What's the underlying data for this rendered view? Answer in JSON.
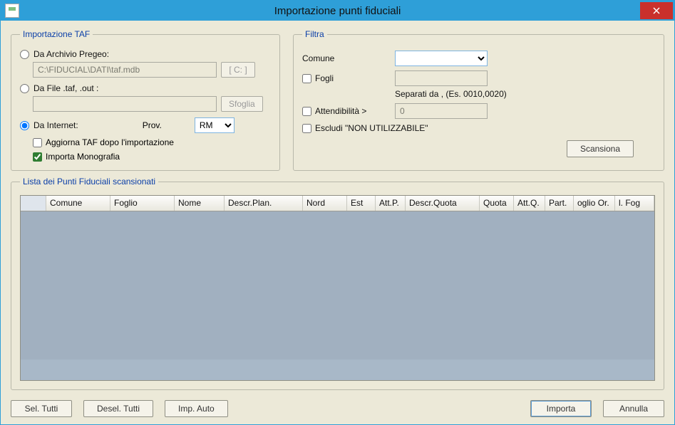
{
  "window": {
    "title": "Importazione punti fiduciali"
  },
  "import_group": {
    "legend": "Importazione TAF",
    "radio_pregeo": "Da Archivio Pregeo:",
    "pregeo_path": "C:\\FIDUCIAL\\DATI\\taf.mdb",
    "drive_btn": "[ C: ]",
    "radio_file": "Da File .taf, .out :",
    "sfoglia_btn": "Sfoglia",
    "radio_internet": "Da Internet:",
    "prov_label": "Prov.",
    "prov_value": "RM",
    "chk_aggiorna": "Aggiorna TAF dopo l'importazione",
    "chk_monografia": "Importa Monografia"
  },
  "filtra_group": {
    "legend": "Filtra",
    "comune_label": "Comune",
    "fogli_label": "Fogli",
    "fogli_hint": "Separati da , (Es. 0010,0020)",
    "attend_label": "Attendibilità >",
    "attend_value": "0",
    "escludi_label": "Escludi \"NON UTILIZZABILE\"",
    "scan_btn": "Scansiona"
  },
  "list_group": {
    "legend": "Lista dei Punti Fiduciali scansionati",
    "cols": [
      "",
      "Comune",
      "Foglio",
      "Nome",
      "Descr.Plan.",
      "Nord",
      "Est",
      "Att.P.",
      "Descr.Quota",
      "Quota",
      "Att.Q.",
      "Part.",
      "oglio Or.",
      "l. Fog"
    ]
  },
  "buttons": {
    "sel_tutti": "Sel. Tutti",
    "desel_tutti": "Desel. Tutti",
    "imp_auto": "Imp. Auto",
    "importa": "Importa",
    "annulla": "Annulla"
  }
}
